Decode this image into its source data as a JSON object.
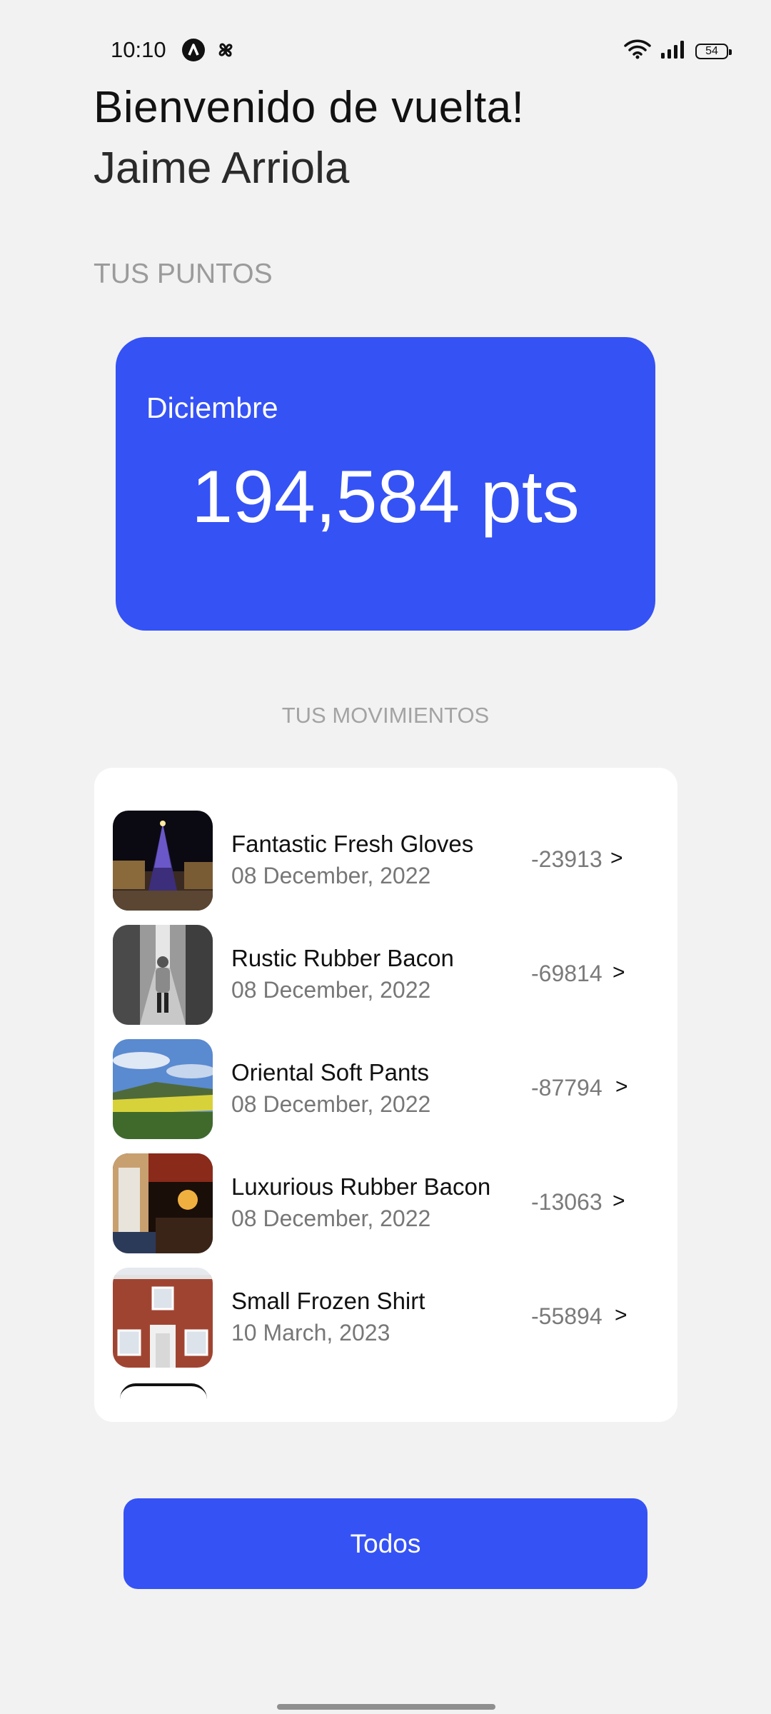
{
  "status_bar": {
    "time": "10:10",
    "battery": "54",
    "icons": [
      "app-a-icon",
      "pinwheel-icon",
      "wifi-icon",
      "signal-icon",
      "battery-icon"
    ]
  },
  "header": {
    "greeting": "Bienvenido de vuelta!",
    "user_name": "Jaime Arriola"
  },
  "points": {
    "section_label": "TUS PUNTOS",
    "month": "Diciembre",
    "value": "194,584 pts"
  },
  "movements": {
    "section_label": "TUS MOVIMIENTOS",
    "items": [
      {
        "title": "Fantastic Fresh Gloves",
        "date": "08 December, 2022",
        "amount": "-23913",
        "chevron": ">",
        "image": "christmas-tree-plaza-photo"
      },
      {
        "title": "Rustic Rubber Bacon",
        "date": "08 December, 2022",
        "amount": "-69814",
        "chevron": ">",
        "image": "alley-person-photo"
      },
      {
        "title": "Oriental Soft Pants",
        "date": "08 December, 2022",
        "amount": "-87794",
        "chevron": ">",
        "image": "countryside-field-photo"
      },
      {
        "title": "Luxurious Rubber Bacon",
        "date": "08 December, 2022",
        "amount": "-13063",
        "chevron": ">",
        "image": "night-street-restaurant-photo"
      },
      {
        "title": "Small Frozen Shirt",
        "date": "10 March, 2023",
        "amount": "-55894",
        "chevron": ">",
        "image": "brick-house-photo"
      }
    ]
  },
  "actions": {
    "all_label": "Todos"
  },
  "colors": {
    "accent": "#3552f5",
    "background": "#f2f2f2",
    "card": "#ffffff"
  }
}
